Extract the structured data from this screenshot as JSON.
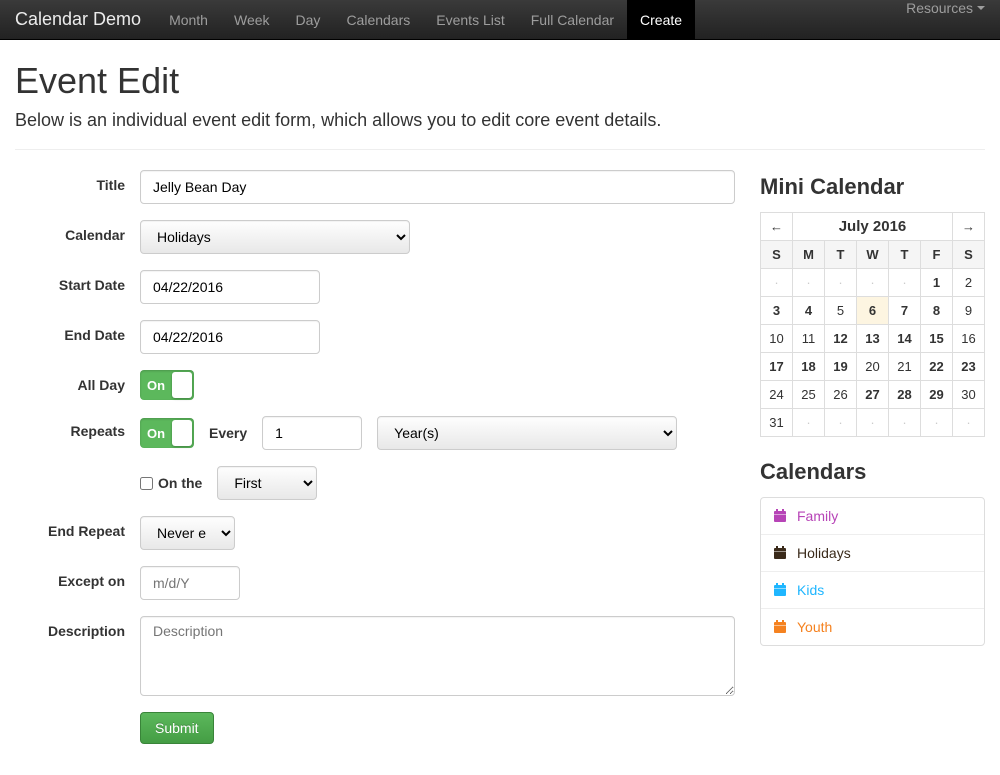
{
  "nav": {
    "brand": "Calendar Demo",
    "items": [
      "Month",
      "Week",
      "Day",
      "Calendars",
      "Events List",
      "Full Calendar",
      "Create"
    ],
    "active_index": 6,
    "right": "Resources"
  },
  "page": {
    "title": "Event Edit",
    "lead": "Below is an individual event edit form, which allows you to edit core event details."
  },
  "form": {
    "labels": {
      "title": "Title",
      "calendar": "Calendar",
      "start_date": "Start Date",
      "end_date": "End Date",
      "all_day": "All Day",
      "repeats": "Repeats",
      "every": "Every",
      "on_the": "On the",
      "end_repeat": "End Repeat",
      "except_on": "Except on",
      "description": "Description"
    },
    "title_value": "Jelly Bean Day",
    "calendar_value": "Holidays",
    "start_date_value": "04/22/2016",
    "end_date_value": "04/22/2016",
    "all_day_toggle": "On",
    "repeats_toggle": "On",
    "repeat_interval": "1",
    "repeat_unit": "Year(s)",
    "on_the_checked": false,
    "on_the_value": "First",
    "end_repeat_value": "Never ends",
    "except_on_placeholder": "m/d/Y",
    "description_placeholder": "Description",
    "submit": "Submit"
  },
  "mini_calendar": {
    "heading": "Mini Calendar",
    "prev": "←",
    "next": "→",
    "title": "July 2016",
    "weekdays": [
      "S",
      "M",
      "T",
      "W",
      "T",
      "F",
      "S"
    ],
    "rows": [
      [
        {
          "d": "·",
          "dim": true
        },
        {
          "d": "·",
          "dim": true
        },
        {
          "d": "·",
          "dim": true
        },
        {
          "d": "·",
          "dim": true
        },
        {
          "d": "·",
          "dim": true
        },
        {
          "d": "1",
          "bold": true
        },
        {
          "d": "2"
        }
      ],
      [
        {
          "d": "3",
          "bold": true
        },
        {
          "d": "4",
          "bold": true
        },
        {
          "d": "5"
        },
        {
          "d": "6",
          "today": true
        },
        {
          "d": "7",
          "bold": true
        },
        {
          "d": "8",
          "bold": true
        },
        {
          "d": "9"
        }
      ],
      [
        {
          "d": "10"
        },
        {
          "d": "11"
        },
        {
          "d": "12",
          "bold": true
        },
        {
          "d": "13",
          "bold": true
        },
        {
          "d": "14",
          "bold": true
        },
        {
          "d": "15",
          "bold": true
        },
        {
          "d": "16"
        }
      ],
      [
        {
          "d": "17",
          "bold": true
        },
        {
          "d": "18",
          "bold": true
        },
        {
          "d": "19",
          "bold": true
        },
        {
          "d": "20"
        },
        {
          "d": "21"
        },
        {
          "d": "22",
          "bold": true
        },
        {
          "d": "23",
          "bold": true
        }
      ],
      [
        {
          "d": "24"
        },
        {
          "d": "25"
        },
        {
          "d": "26"
        },
        {
          "d": "27",
          "bold": true
        },
        {
          "d": "28",
          "bold": true
        },
        {
          "d": "29",
          "bold": true
        },
        {
          "d": "30"
        }
      ],
      [
        {
          "d": "31"
        },
        {
          "d": "·",
          "dim": true
        },
        {
          "d": "·",
          "dim": true
        },
        {
          "d": "·",
          "dim": true
        },
        {
          "d": "·",
          "dim": true
        },
        {
          "d": "·",
          "dim": true
        },
        {
          "d": "·",
          "dim": true
        }
      ]
    ]
  },
  "calendars": {
    "heading": "Calendars",
    "items": [
      {
        "label": "Family",
        "color": "#b744b7"
      },
      {
        "label": "Holidays",
        "color": "#3a2a1a"
      },
      {
        "label": "Kids",
        "color": "#1fb6ff"
      },
      {
        "label": "Youth",
        "color": "#f58220"
      }
    ]
  }
}
